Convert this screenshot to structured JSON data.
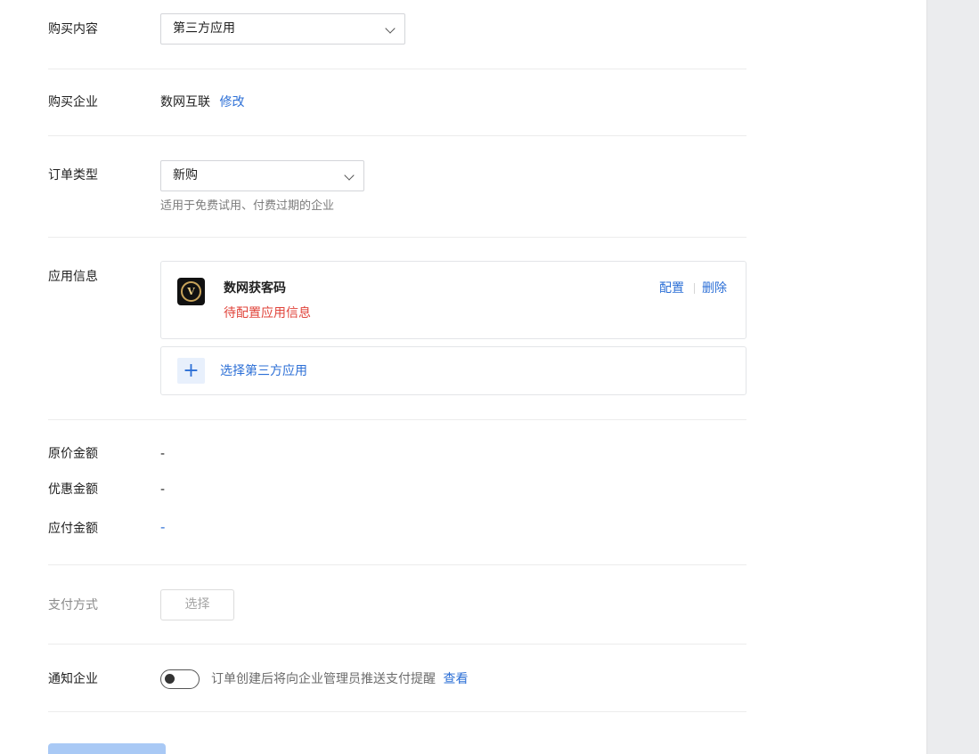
{
  "form": {
    "purchase_content": {
      "label": "购买内容",
      "value": "第三方应用"
    },
    "purchase_company": {
      "label": "购买企业",
      "value": "数网互联",
      "edit_link": "修改"
    },
    "order_type": {
      "label": "订单类型",
      "value": "新购",
      "hint": "适用于免费试用、付费过期的企业"
    },
    "app_info": {
      "label": "应用信息",
      "app": {
        "name": "数网获客码",
        "status": "待配置应用信息",
        "configure": "配置",
        "delete": "删除",
        "icon_letter": "V"
      },
      "add_app": "选择第三方应用"
    },
    "amounts": {
      "original": {
        "label": "原价金额",
        "value": "-"
      },
      "discount": {
        "label": "优惠金额",
        "value": "-"
      },
      "payable": {
        "label": "应付金额",
        "value": "-"
      }
    },
    "payment": {
      "label": "支付方式",
      "button": "选择"
    },
    "notify": {
      "label": "通知企业",
      "text": "订单创建后将向企业管理员推送支付提醒",
      "view_link": "查看",
      "enabled": false
    }
  },
  "colors": {
    "accent": "#2c6fd6",
    "danger": "#e0433a",
    "submit": "#a9c9f5"
  }
}
